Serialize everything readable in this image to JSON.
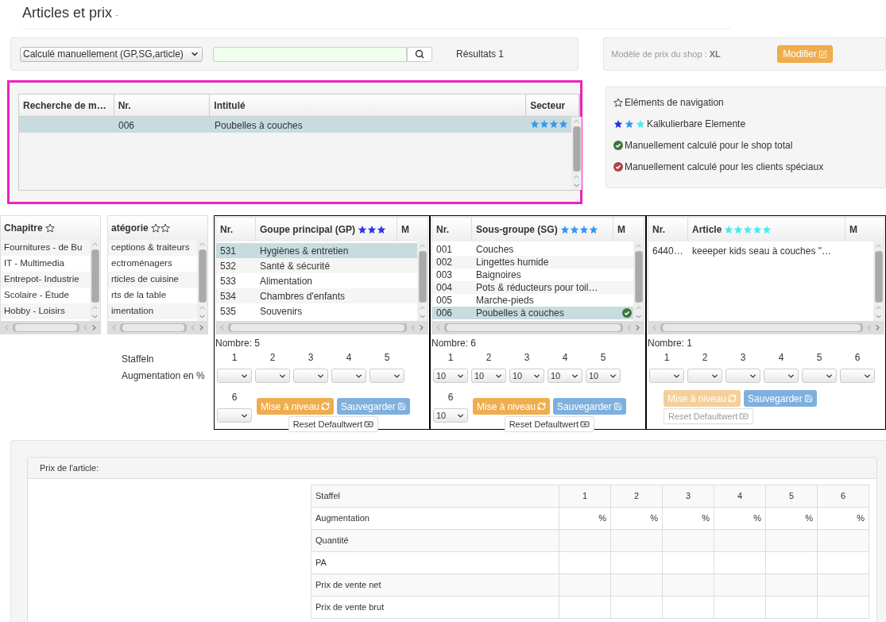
{
  "page": {
    "title": "Articles et prix",
    "subtitle": "-"
  },
  "filter": {
    "mode": "Calculé manuellement (GP,SG,article)",
    "results": "Résultats 1"
  },
  "shop_model": {
    "label": "Modèle de prix du shop :",
    "value": "XL",
    "button": "Modifier"
  },
  "search_results": {
    "columns": [
      "Recherche de m…",
      "Nr.",
      "Intitulé",
      "Secteur"
    ],
    "rows": [
      {
        "selected": true,
        "nr": "006",
        "title": "Poubelles à couches",
        "stars": 4,
        "color": "#3399ee"
      }
    ]
  },
  "legend": [
    {
      "kind": "outline-star",
      "label": "Eléments de navigation"
    },
    {
      "kind": "tricolor-stars",
      "label": "Kalkulierbare Elemente"
    },
    {
      "kind": "check",
      "color": "#3c763d",
      "label": "Manuellement calculé pour le shop total"
    },
    {
      "kind": "check",
      "color": "#a94442",
      "label": "Manuellement calculé pour les clients spéciaux"
    }
  ],
  "tree_lists": [
    {
      "title": "Chapitre",
      "title_icons": [
        {
          "kind": "outline-star"
        }
      ],
      "items": [
        {
          "label": "Fournitures - de Bu",
          "selected": false
        },
        {
          "label": "IT - Multimedia",
          "selected": false
        },
        {
          "label": "Entrepot- Industrie",
          "selected": false
        },
        {
          "label": "Scolaire - Étude",
          "selected": false
        },
        {
          "label": "Hobby - Loisirs",
          "selected": false
        }
      ]
    },
    {
      "title": "atégorie",
      "title_icons": [
        {
          "kind": "outline-star"
        },
        {
          "kind": "outline-star"
        }
      ],
      "items": [
        {
          "label": "ceptions & traiteurs",
          "selected": false
        },
        {
          "label": "ectroménagers",
          "selected": false
        },
        {
          "label": "rticles de cuisine",
          "selected": false
        },
        {
          "label": "rts de la table",
          "selected": false
        },
        {
          "label": "imentation",
          "selected": false
        }
      ]
    }
  ],
  "staffel_labels": [
    "Staffeln",
    "Augmentation en %"
  ],
  "groups": [
    {
      "columns": [
        "Nr.",
        "Goupe principal (GP)",
        "M"
      ],
      "stars": 3,
      "color": "#3333ee",
      "disabled": false,
      "count": "Nombre: 5",
      "rows": [
        {
          "nr": "531",
          "name": "Hygiènes & entretien",
          "selected": true,
          "checked": false
        },
        {
          "nr": "532",
          "name": "Santé & sécurité",
          "selected": false,
          "checked": false
        },
        {
          "nr": "533",
          "name": "Alimentation",
          "selected": false,
          "checked": false
        },
        {
          "nr": "534",
          "name": "Chambres d'enfants",
          "selected": false,
          "checked": false
        },
        {
          "nr": "535",
          "name": "Souvenirs",
          "selected": false,
          "checked": false
        }
      ],
      "staffel": [
        {
          "label": "1"
        },
        {
          "label": "2"
        },
        {
          "label": "3"
        },
        {
          "label": "4"
        },
        {
          "label": "5"
        },
        {
          "label": "6"
        }
      ],
      "buttons": {
        "level": "Mise à niveau",
        "save": "Sauvegarder",
        "reset": "Reset Defaultwert"
      }
    },
    {
      "columns": [
        "Nr.",
        "Sous-groupe (SG)",
        "M"
      ],
      "stars": 4,
      "color": "#3399ee",
      "disabled": false,
      "count": "Nombre: 6",
      "rows": [
        {
          "nr": "001",
          "name": "Couches",
          "selected": false,
          "checked": false
        },
        {
          "nr": "002",
          "name": "Lingettes humide",
          "selected": false,
          "checked": false
        },
        {
          "nr": "003",
          "name": "Baignoires",
          "selected": false,
          "checked": false
        },
        {
          "nr": "004",
          "name": "Pots & réducteurs pour toil…",
          "selected": false,
          "checked": false
        },
        {
          "nr": "005",
          "name": "Marche-pieds",
          "selected": false,
          "checked": false
        },
        {
          "nr": "006",
          "name": "Poubelles à couches",
          "selected": true,
          "checked": true
        }
      ],
      "staffel": [
        {
          "label": "1",
          "value": "10"
        },
        {
          "label": "2",
          "value": "10"
        },
        {
          "label": "3",
          "value": "10"
        },
        {
          "label": "4",
          "value": "10"
        },
        {
          "label": "5",
          "value": "10"
        },
        {
          "label": "6",
          "value": "10"
        }
      ],
      "buttons": {
        "level": "Mise à niveau",
        "save": "Sauvegarder",
        "reset": "Reset Defaultwert"
      }
    },
    {
      "columns": [
        "Nr.",
        "Article",
        "M"
      ],
      "stars": 5,
      "color": "#44eeee",
      "disabled": true,
      "count": "Nombre: 1",
      "rows": [
        {
          "nr": "6440…",
          "name": "keeeper kids seau à couches \"…",
          "selected": false,
          "checked": false
        }
      ],
      "staffel": [
        {
          "label": "1"
        },
        {
          "label": "2"
        },
        {
          "label": "3"
        },
        {
          "label": "4"
        },
        {
          "label": "5"
        },
        {
          "label": "6"
        }
      ],
      "buttons": {
        "level": "Mise à niveau",
        "save": "Sauvegarder",
        "reset": "Reset Defaultwert"
      }
    }
  ],
  "price": {
    "title": "Prix de l'article:",
    "header": [
      "Staffel",
      "1",
      "2",
      "3",
      "4",
      "5",
      "6"
    ],
    "rows": [
      {
        "label": "Augmentation",
        "cells": [
          "%",
          "%",
          "%",
          "%",
          "%",
          "%"
        ]
      },
      {
        "label": "Quantité"
      },
      {
        "label": "PA"
      },
      {
        "label": "Prix de vente net"
      },
      {
        "label": "Prix de vente brut"
      }
    ]
  }
}
